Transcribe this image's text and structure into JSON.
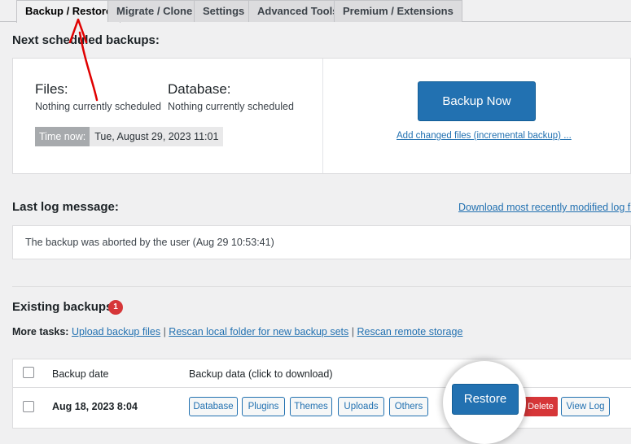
{
  "tabs": [
    {
      "label": "Backup / Restore",
      "active": true
    },
    {
      "label": "Migrate / Clone"
    },
    {
      "label": "Settings"
    },
    {
      "label": "Advanced Tools"
    },
    {
      "label": "Premium / Extensions"
    }
  ],
  "scheduled": {
    "heading": "Next scheduled backups:",
    "files_label": "Files:",
    "files_value": "Nothing currently scheduled",
    "database_label": "Database:",
    "database_value": "Nothing currently scheduled",
    "time_now_label": "Time now:",
    "time_now_value": "Tue, August 29, 2023 11:01",
    "backup_now_label": "Backup Now",
    "incremental_link": "Add changed files (incremental backup) ..."
  },
  "log": {
    "heading": "Last log message:",
    "download_link": "Download most recently modified log file",
    "message": "The backup was aborted by the user (Aug 29 10:53:41)"
  },
  "existing": {
    "heading": "Existing backups",
    "count": "1",
    "more_tasks_label": "More tasks:",
    "tasks": [
      "Upload backup files",
      "Rescan local folder for new backup sets",
      "Rescan remote storage"
    ],
    "separator": "|",
    "columns": {
      "date": "Backup date",
      "data": "Backup data (click to download)"
    },
    "row": {
      "date": "Aug 18, 2023 8:04",
      "data_buttons": [
        "Database",
        "Plugins",
        "Themes",
        "Uploads",
        "Others"
      ],
      "restore_label": "Restore",
      "delete_label": "Delete",
      "view_log_label": "View Log"
    }
  },
  "colors": {
    "primary": "#2271b1",
    "danger": "#d63638",
    "annotation": "#e00000"
  }
}
